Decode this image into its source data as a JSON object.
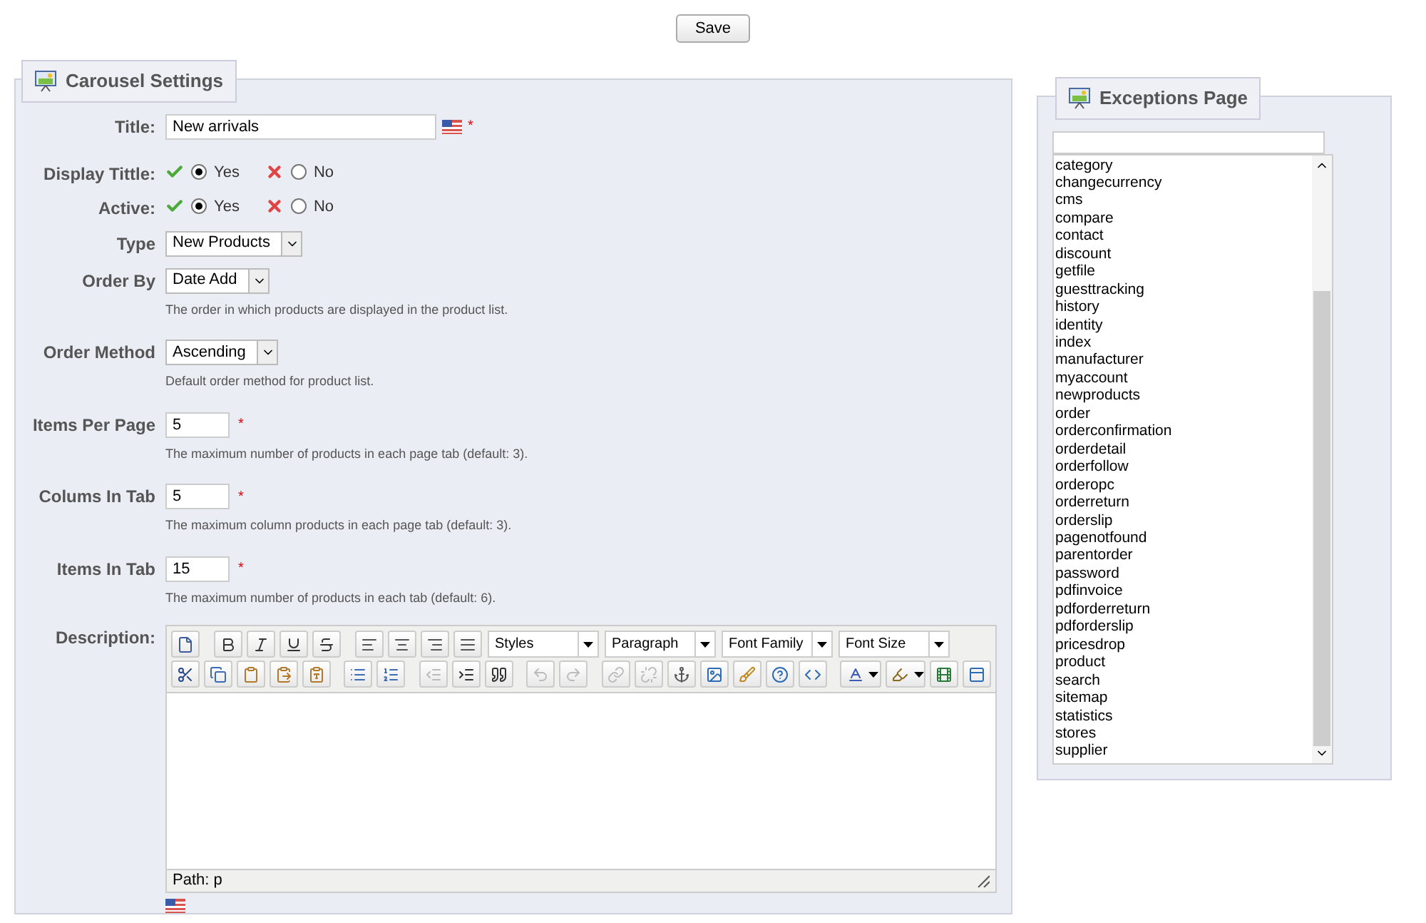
{
  "save_button": "Save",
  "carousel": {
    "legend": "Carousel Settings",
    "fields": [
      {
        "kind": "text",
        "label": "Title:",
        "value": "New arrivals",
        "flag": true,
        "required": "*"
      },
      {
        "kind": "radio",
        "label": "Display Tittle:",
        "options": [
          {
            "kind": "yes",
            "label": "Yes",
            "selected": true
          },
          {
            "kind": "no",
            "label": "No",
            "selected": false
          }
        ]
      },
      {
        "kind": "radio",
        "label": "Active:",
        "options": [
          {
            "kind": "yes",
            "label": "Yes",
            "selected": true
          },
          {
            "kind": "no",
            "label": "No",
            "selected": false
          }
        ]
      },
      {
        "kind": "select",
        "label": "Type",
        "value": "New Products"
      },
      {
        "kind": "select",
        "label": "Order By",
        "value": "Date Add",
        "help": "The order in which products are displayed in the product list."
      },
      {
        "kind": "select",
        "label": "Order Method",
        "value": "Ascending",
        "help": "Default order method for product list."
      },
      {
        "kind": "number",
        "label": "Items Per Page",
        "value": "5",
        "required": "*",
        "help": "The maximum number of products in each page tab (default: 3)."
      },
      {
        "kind": "number",
        "label": "Colums In Tab",
        "value": "5",
        "required": "*",
        "help": "The maximum column products in each page tab (default: 3)."
      },
      {
        "kind": "number",
        "label": "Items In Tab",
        "value": "15",
        "required": "*",
        "help": "The maximum number of products in each tab (default: 6)."
      }
    ],
    "description": {
      "label": "Description:",
      "path": "Path: p",
      "toolbar": [
        [
          {
            "kind": "button",
            "disabled": false
          },
          {
            "kind": "separator"
          },
          {
            "kind": "button",
            "disabled": false
          },
          {
            "kind": "button",
            "disabled": false
          },
          {
            "kind": "button",
            "disabled": false
          },
          {
            "kind": "button",
            "disabled": false
          },
          {
            "kind": "separator"
          },
          {
            "kind": "button",
            "disabled": false
          },
          {
            "kind": "button",
            "disabled": false
          },
          {
            "kind": "button",
            "disabled": false
          },
          {
            "kind": "button",
            "disabled": false
          },
          {
            "kind": "dropdown",
            "label": "Styles"
          },
          {
            "kind": "dropdown",
            "label": "Paragraph"
          },
          {
            "kind": "dropdown",
            "label": "Font Family"
          },
          {
            "kind": "dropdown",
            "label": "Font Size"
          }
        ],
        [
          {
            "kind": "button",
            "disabled": false
          },
          {
            "kind": "button",
            "disabled": false
          },
          {
            "kind": "button",
            "disabled": false
          },
          {
            "kind": "button",
            "disabled": false
          },
          {
            "kind": "button",
            "disabled": false
          },
          {
            "kind": "separator"
          },
          {
            "kind": "button",
            "disabled": false
          },
          {
            "kind": "button",
            "disabled": false
          },
          {
            "kind": "separator"
          },
          {
            "kind": "button",
            "disabled": true
          },
          {
            "kind": "button",
            "disabled": false
          },
          {
            "kind": "button",
            "disabled": false
          },
          {
            "kind": "separator"
          },
          {
            "kind": "button",
            "disabled": true
          },
          {
            "kind": "button",
            "disabled": true
          },
          {
            "kind": "separator"
          },
          {
            "kind": "button",
            "disabled": true
          },
          {
            "kind": "button",
            "disabled": true
          },
          {
            "kind": "button",
            "disabled": false
          },
          {
            "kind": "button",
            "disabled": false
          },
          {
            "kind": "button",
            "disabled": false
          },
          {
            "kind": "button",
            "disabled": false
          },
          {
            "kind": "button",
            "disabled": false
          },
          {
            "kind": "separator"
          },
          {
            "kind": "split",
            "disabled": false
          },
          {
            "kind": "split",
            "disabled": false
          },
          {
            "kind": "button",
            "disabled": false
          },
          {
            "kind": "button",
            "disabled": false
          }
        ]
      ]
    }
  },
  "exceptions": {
    "legend": "Exceptions Page",
    "items": [
      "category",
      "changecurrency",
      "cms",
      "compare",
      "contact",
      "discount",
      "getfile",
      "guesttracking",
      "history",
      "identity",
      "index",
      "manufacturer",
      "myaccount",
      "newproducts",
      "order",
      "orderconfirmation",
      "orderdetail",
      "orderfollow",
      "orderopc",
      "orderreturn",
      "orderslip",
      "pagenotfound",
      "parentorder",
      "password",
      "pdfinvoice",
      "pdforderreturn",
      "pdforderslip",
      "pricesdrop",
      "product",
      "search",
      "sitemap",
      "statistics",
      "stores",
      "supplier"
    ]
  }
}
